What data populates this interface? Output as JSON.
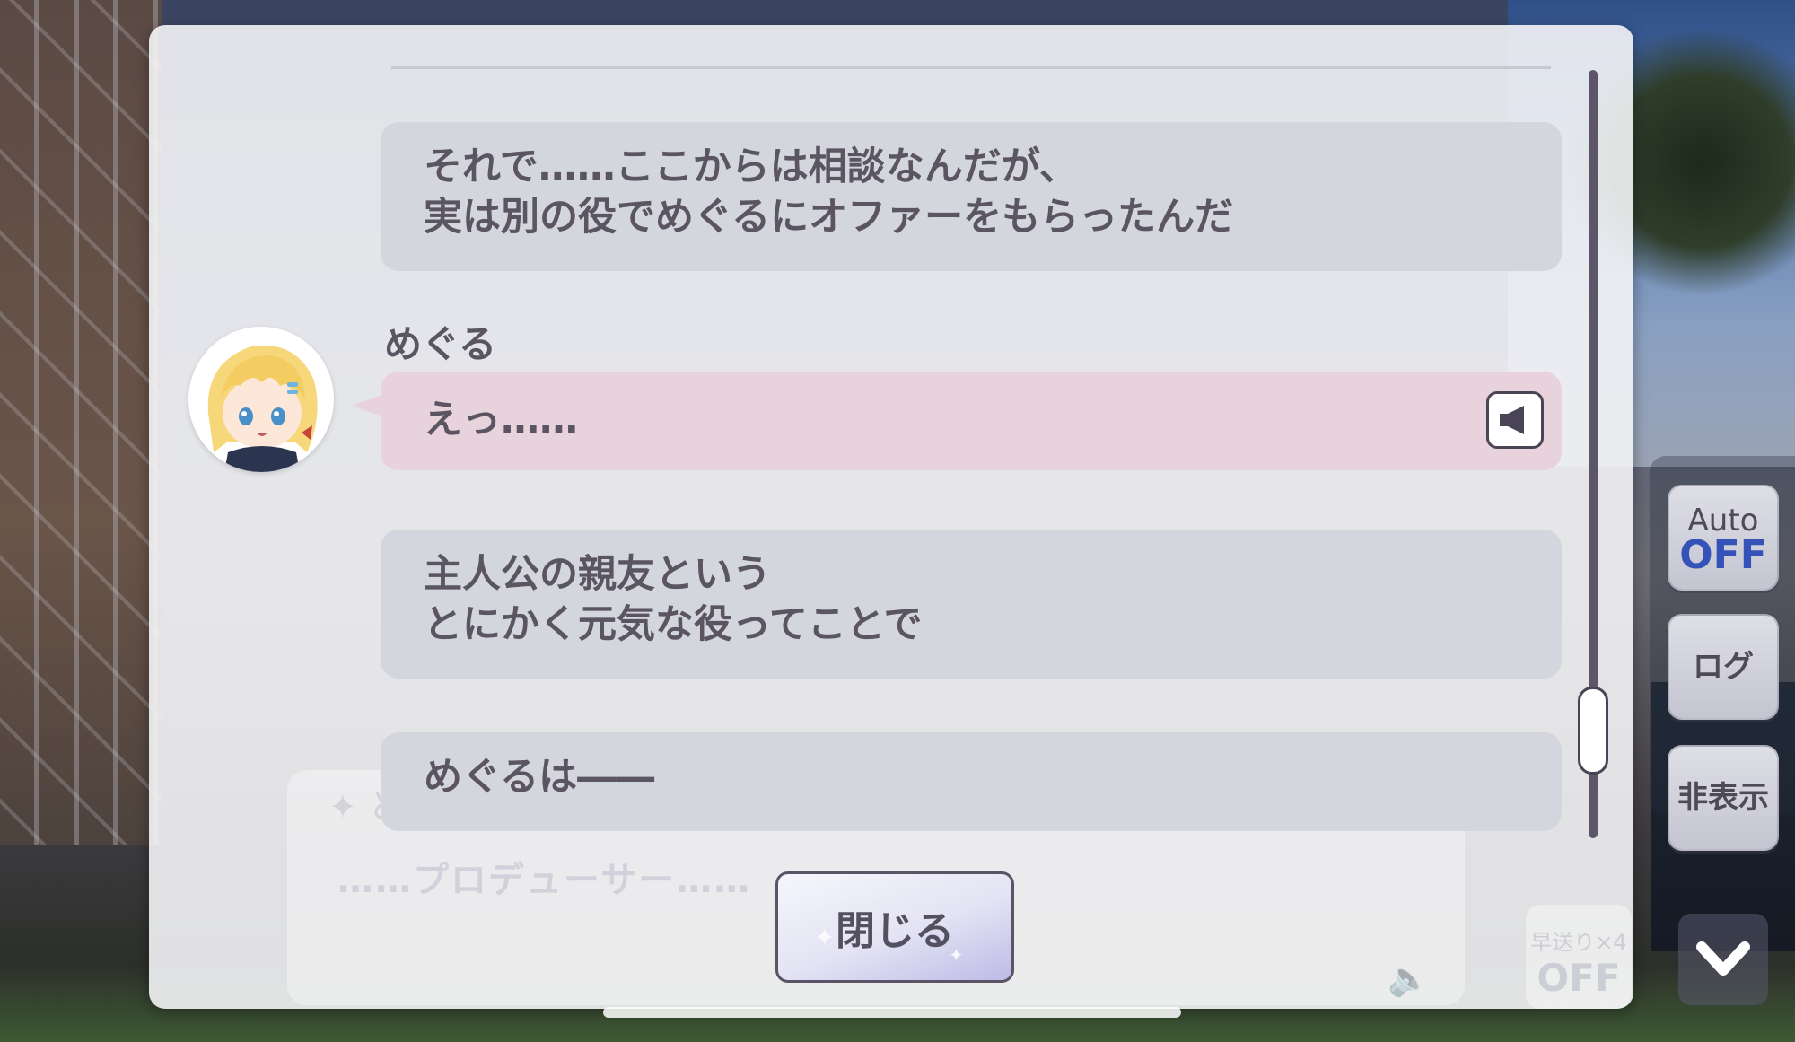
{
  "log": {
    "messages": [
      {
        "lines": [
          "それで……ここからは相談なんだが、",
          "実は別の役でめぐるにオファーをもらったんだ"
        ]
      },
      {
        "speaker": "めぐる",
        "lines": [
          "えっ……"
        ]
      },
      {
        "lines": [
          "主人公の親友という",
          "とにかく元気な役ってことで"
        ]
      },
      {
        "lines": [
          "めぐるは――"
        ]
      }
    ],
    "close_label": "閉じる"
  },
  "underlying": {
    "speaker_initial": "✦ と",
    "text": "……プロデューサー……",
    "fast_forward_label": "早送り×4",
    "fast_forward_state": "OFF"
  },
  "side": {
    "auto_label": "Auto",
    "auto_state": "OFF",
    "log_label": "ログ",
    "hide_label": "非表示"
  },
  "colors": {
    "bubble_default": "#d4d6dd",
    "bubble_speaker": "#e8d3dc",
    "text": "#5a5560",
    "auto_off": "#3452b7"
  },
  "icons": {
    "voice": "speaker-icon",
    "avatar": "meguru-avatar",
    "down": "chevron-down-icon"
  }
}
